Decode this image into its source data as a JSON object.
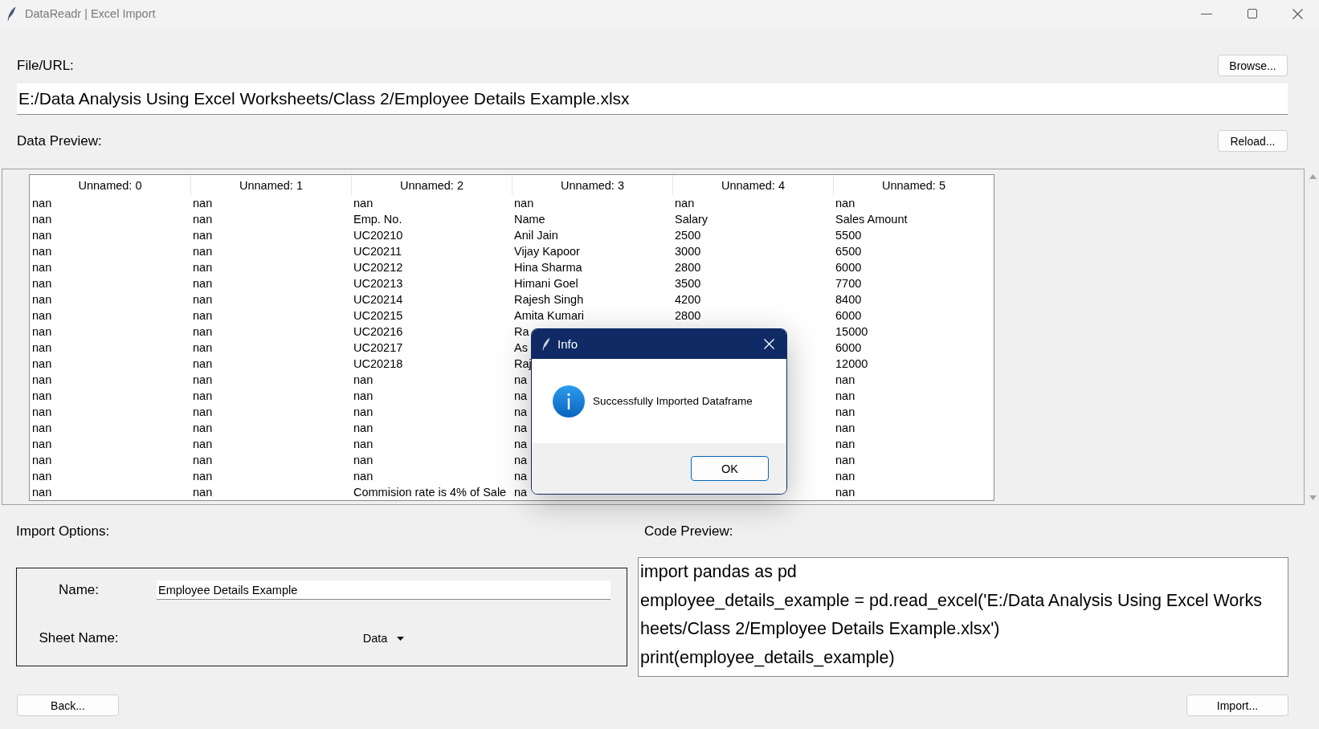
{
  "window": {
    "title": "DataReadr | Excel Import"
  },
  "file_url": {
    "label": "File/URL:",
    "button": "Browse...",
    "value": "E:/Data Analysis Using Excel Worksheets/Class 2/Employee Details Example.xlsx"
  },
  "data_preview": {
    "label": "Data Preview:",
    "button": "Reload...",
    "table": {
      "columns": [
        "Unnamed: 0",
        "Unnamed: 1",
        "Unnamed: 2",
        "Unnamed: 3",
        "Unnamed: 4",
        "Unnamed: 5"
      ],
      "rows": [
        [
          "nan",
          "nan",
          "nan",
          "nan",
          "nan",
          "nan"
        ],
        [
          "nan",
          "nan",
          "Emp. No.",
          "Name",
          "Salary",
          "Sales Amount"
        ],
        [
          "nan",
          "nan",
          "UC20210",
          "Anil Jain",
          "2500",
          "5500"
        ],
        [
          "nan",
          "nan",
          "UC20211",
          "Vijay Kapoor",
          "3000",
          "6500"
        ],
        [
          "nan",
          "nan",
          "UC20212",
          "Hina Sharma",
          "2800",
          "6000"
        ],
        [
          "nan",
          "nan",
          "UC20213",
          "Himani Goel",
          "3500",
          "7700"
        ],
        [
          "nan",
          "nan",
          "UC20214",
          "Rajesh Singh",
          "4200",
          "8400"
        ],
        [
          "nan",
          "nan",
          "UC20215",
          "Amita Kumari",
          "2800",
          "6000"
        ],
        [
          "nan",
          "nan",
          "UC20216",
          "Ra",
          null,
          "15000"
        ],
        [
          "nan",
          "nan",
          "UC20217",
          "As",
          null,
          "6000"
        ],
        [
          "nan",
          "nan",
          "UC20218",
          "Raj",
          null,
          "12000"
        ],
        [
          "nan",
          "nan",
          "nan",
          "na",
          null,
          "nan"
        ],
        [
          "nan",
          "nan",
          "nan",
          "na",
          null,
          "nan"
        ],
        [
          "nan",
          "nan",
          "nan",
          "na",
          null,
          "nan"
        ],
        [
          "nan",
          "nan",
          "nan",
          "na",
          null,
          "nan"
        ],
        [
          "nan",
          "nan",
          "nan",
          "na",
          null,
          "nan"
        ],
        [
          "nan",
          "nan",
          "nan",
          "na",
          null,
          "nan"
        ],
        [
          "nan",
          "nan",
          "nan",
          "na",
          null,
          "nan"
        ],
        [
          "nan",
          "nan",
          "Commision rate is 4% of Sale",
          "na",
          null,
          "nan"
        ]
      ]
    }
  },
  "import_options": {
    "label": "Import Options:",
    "fields": [
      {
        "kind": "text",
        "label": "Name:",
        "value": "Employee Details Example"
      },
      {
        "kind": "dropdown",
        "label": "Sheet Name:",
        "value": "Data"
      }
    ]
  },
  "code_preview": {
    "label": "Code Preview:",
    "lines": [
      "import pandas as pd",
      "employee_details_example = pd.read_excel('E:/Data Analysis Using Excel Works",
      "heets/Class 2/Employee Details Example.xlsx')",
      "print(employee_details_example)"
    ]
  },
  "footer": {
    "back": "Back...",
    "import": "Import..."
  },
  "dialog": {
    "title": "Info",
    "message": "Successfully Imported Dataframe",
    "button": "OK"
  }
}
